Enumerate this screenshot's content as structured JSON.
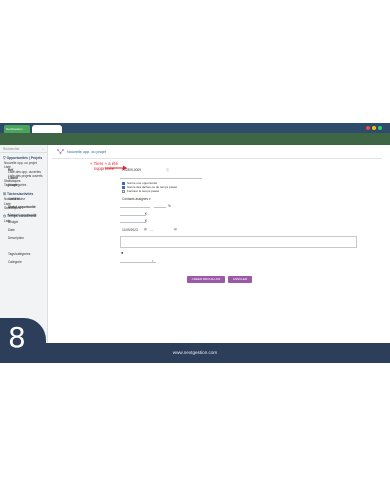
{
  "topbar": {
    "tab_label": "NextGestion",
    "dot_colors": [
      "#e74c3c",
      "#f1c40f",
      "#2ecc71"
    ]
  },
  "sidebar": {
    "search_label": "Rechercher",
    "sections": [
      {
        "title": "Opportunités | Projets",
        "items": [
          "Nouvelle opp. ou projet",
          "Liste"
        ],
        "subitems": [
          "Liste des opp. ouvertes",
          "Liste des projets ouverts"
        ],
        "after": [
          "Statistiques",
          "Tags/catégories"
        ]
      },
      {
        "title": "Tâches/activités",
        "items": [
          "Nouvelle tâche",
          "Liste",
          "Statistiques"
        ]
      },
      {
        "title": "Temps consommé",
        "items": [
          "Liste"
        ]
      }
    ]
  },
  "main": {
    "page_title": "Nouvelle opp. ou projet",
    "fields": {
      "ref_label": "Réf.",
      "ref_value": "PJ2309-0009",
      "libelle_label": "Libellé",
      "usage_label": "Usage",
      "usage_options": [
        "Suivre une opportunité",
        "Suivre des tâches ou du temps passé",
        "Facturer le temps passé"
      ],
      "visibility_label": "Visibilité",
      "visibility_value": "Contacts assignés",
      "statut_label": "Statut opportunité",
      "percent_sign": "%",
      "montant_label": "Montant opportunité",
      "budget_label": "Budget",
      "dates_label": "Date",
      "date_value": "11/09/2023",
      "description_label": "Description",
      "tags_label": "Tags/catégories",
      "categorie_label": "Catégorie"
    },
    "annotation": "« Tiers » a été supprimée",
    "buttons": {
      "create": "CREER BROUILLON",
      "cancel": "ANNULER"
    }
  },
  "footer": {
    "url": "www.nextgestion.com",
    "slide_number": "8"
  }
}
